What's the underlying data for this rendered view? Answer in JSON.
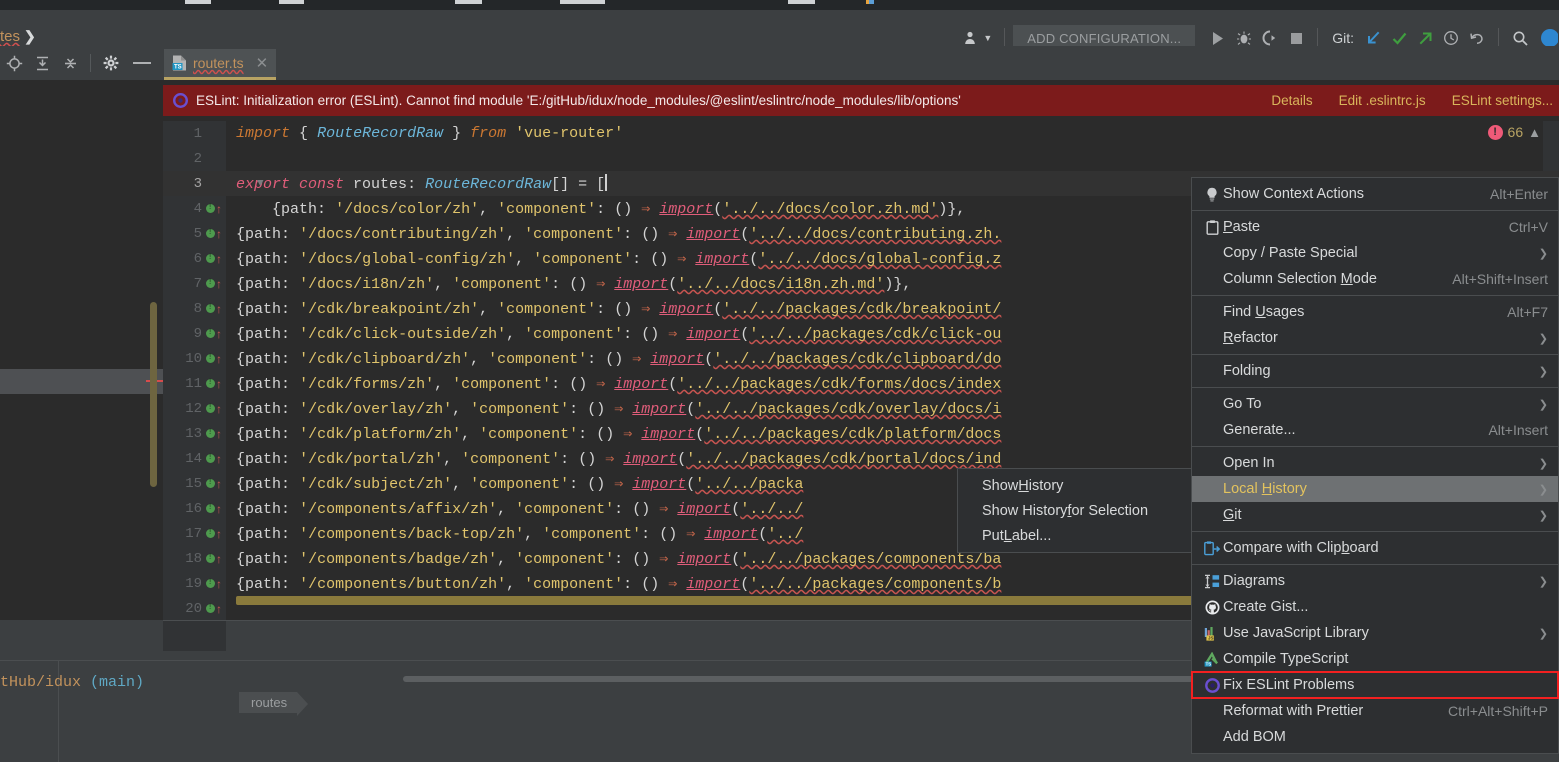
{
  "window": {
    "breadcrumb_tail": "tes",
    "branch_status": "tHub/idux (main)"
  },
  "navbar": {
    "user_icon": "user-dropdown-icon",
    "add_configuration": "ADD CONFIGURATION...",
    "run_icon": "run-icon",
    "debug_icon": "debug-icon",
    "coverage_icon": "run-with-coverage-icon",
    "stop_icon": "stop-icon",
    "git_label": "Git:",
    "update_project_icon": "update-project-icon",
    "commit_icon": "commit-checkmark-icon",
    "push_icon": "push-arrow-icon",
    "history_icon": "history-clock-icon",
    "rollback_icon": "rollback-undo-icon",
    "search_icon": "search-icon",
    "help_icon": "help-icon"
  },
  "toolstrip": {
    "locate_icon": "locate-target-icon",
    "expand_all_icon": "expand-all-icon",
    "collapse_all_icon": "collapse-all-icon",
    "settings_icon": "gear-icon",
    "hide_icon": "minimize-icon"
  },
  "tab": {
    "filetype_icon": "typescript-file-icon",
    "filename": "router.ts",
    "close_icon": "close-icon"
  },
  "error_banner": {
    "status_icon": "eslint-error-icon",
    "message": "ESLint: Initialization error (ESLint). Cannot find module 'E:/gitHub/idux/node_modules/@eslint/eslintrc/node_modules/lib/options'",
    "actions": [
      "Details",
      "Edit .eslintrc.js",
      "ESLint settings..."
    ],
    "banner_color": "#7c1b1b",
    "action_color": "#d9b55b"
  },
  "inspector": {
    "error_badge": "!",
    "error_count": "66",
    "chevron_icon": "chevron-up-icon"
  },
  "editor": {
    "breadcrumb_chip": "routes",
    "lines": [
      {
        "no": "1",
        "marks": false,
        "html": "<span class=\"kw\">import</span> <span class=\"pln\">{</span> <span class=\"typ\">RouteRecordRaw</span> <span class=\"pln\">}</span> <span class=\"kw\">from</span> <span class=\"str\">'vue-router'</span>"
      },
      {
        "no": "2",
        "marks": false,
        "html": ""
      },
      {
        "no": "3",
        "marks": false,
        "html": "<span class=\"pink\">export const</span> <span class=\"pln\">routes</span><span class=\"pnc\">:</span> <span class=\"typ\">RouteRecordRaw</span><span class=\"pnc\">[] = [</span><span class=\"caret\"></span>"
      },
      {
        "no": "4",
        "marks": true,
        "html": "&nbsp;&nbsp;&nbsp;&nbsp;<span class=\"pln\">{</span><span class=\"pln\">path</span><span class=\"pnc\">:</span> <span class=\"str\">'/docs/color/zh'</span><span class=\"pnc\">,</span> <span class=\"str\">'component'</span><span class=\"pnc\">:</span> <span class=\"pnc\">()</span> <span class=\"arrowfat\">&rArr;</span> <span class=\"imp\">import</span><span class=\"pnc\">(</span><span class=\"str squiggle\">'../../docs/color.zh.md'</span><span class=\"pnc\">)},</span>"
      },
      {
        "no": "5",
        "marks": true,
        "html": "<span class=\"pln\">{</span><span class=\"pln\">path</span><span class=\"pnc\">:</span> <span class=\"str\">'/docs/contributing/zh'</span><span class=\"pnc\">,</span> <span class=\"str\">'component'</span><span class=\"pnc\">:</span> <span class=\"pnc\">()</span> <span class=\"arrowfat\">&rArr;</span> <span class=\"imp\">import</span><span class=\"pnc\">(</span><span class=\"str squiggle\">'../../docs/contributing.zh.</span>"
      },
      {
        "no": "6",
        "marks": true,
        "html": "<span class=\"pln\">{</span><span class=\"pln\">path</span><span class=\"pnc\">:</span> <span class=\"str\">'/docs/global-config/zh'</span><span class=\"pnc\">,</span> <span class=\"str\">'component'</span><span class=\"pnc\">:</span> <span class=\"pnc\">()</span> <span class=\"arrowfat\">&rArr;</span> <span class=\"imp\">import</span><span class=\"pnc\">(</span><span class=\"str squiggle\">'../../docs/global-config.z</span>"
      },
      {
        "no": "7",
        "marks": true,
        "html": "<span class=\"pln\">{</span><span class=\"pln\">path</span><span class=\"pnc\">:</span> <span class=\"str\">'/docs/i18n/zh'</span><span class=\"pnc\">,</span> <span class=\"str\">'component'</span><span class=\"pnc\">:</span> <span class=\"pnc\">()</span> <span class=\"arrowfat\">&rArr;</span> <span class=\"imp\">import</span><span class=\"pnc\">(</span><span class=\"str squiggle\">'../../docs/i18n.zh.md'</span><span class=\"pnc\">)},</span>"
      },
      {
        "no": "8",
        "marks": true,
        "html": "<span class=\"pln\">{</span><span class=\"pln\">path</span><span class=\"pnc\">:</span> <span class=\"str\">'/cdk/breakpoint/zh'</span><span class=\"pnc\">,</span> <span class=\"str\">'component'</span><span class=\"pnc\">:</span> <span class=\"pnc\">()</span> <span class=\"arrowfat\">&rArr;</span> <span class=\"imp\">import</span><span class=\"pnc\">(</span><span class=\"str squiggle\">'../../packages/cdk/breakpoint/</span>"
      },
      {
        "no": "9",
        "marks": true,
        "html": "<span class=\"pln\">{</span><span class=\"pln\">path</span><span class=\"pnc\">:</span> <span class=\"str\">'/cdk/click-outside/zh'</span><span class=\"pnc\">,</span> <span class=\"str\">'component'</span><span class=\"pnc\">:</span> <span class=\"pnc\">()</span> <span class=\"arrowfat\">&rArr;</span> <span class=\"imp\">import</span><span class=\"pnc\">(</span><span class=\"str squiggle\">'../../packages/cdk/click-ou</span>"
      },
      {
        "no": "10",
        "marks": true,
        "html": "<span class=\"pln\">{</span><span class=\"pln\">path</span><span class=\"pnc\">:</span> <span class=\"str\">'/cdk/clipboard/zh'</span><span class=\"pnc\">,</span> <span class=\"str\">'component'</span><span class=\"pnc\">:</span> <span class=\"pnc\">()</span> <span class=\"arrowfat\">&rArr;</span> <span class=\"imp\">import</span><span class=\"pnc\">(</span><span class=\"str squiggle\">'../../packages/cdk/clipboard/do</span>"
      },
      {
        "no": "11",
        "marks": true,
        "html": "<span class=\"pln\">{</span><span class=\"pln\">path</span><span class=\"pnc\">:</span> <span class=\"str\">'/cdk/forms/zh'</span><span class=\"pnc\">,</span> <span class=\"str\">'component'</span><span class=\"pnc\">:</span> <span class=\"pnc\">()</span> <span class=\"arrowfat\">&rArr;</span> <span class=\"imp\">import</span><span class=\"pnc\">(</span><span class=\"str squiggle\">'../../packages/cdk/forms/docs/index</span>"
      },
      {
        "no": "12",
        "marks": true,
        "html": "<span class=\"pln\">{</span><span class=\"pln\">path</span><span class=\"pnc\">:</span> <span class=\"str\">'/cdk/overlay/zh'</span><span class=\"pnc\">,</span> <span class=\"str\">'component'</span><span class=\"pnc\">:</span> <span class=\"pnc\">()</span> <span class=\"arrowfat\">&rArr;</span> <span class=\"imp\">import</span><span class=\"pnc\">(</span><span class=\"str squiggle\">'../../packages/cdk/overlay/docs/i</span>"
      },
      {
        "no": "13",
        "marks": true,
        "html": "<span class=\"pln\">{</span><span class=\"pln\">path</span><span class=\"pnc\">:</span> <span class=\"str\">'/cdk/platform/zh'</span><span class=\"pnc\">,</span> <span class=\"str\">'component'</span><span class=\"pnc\">:</span> <span class=\"pnc\">()</span> <span class=\"arrowfat\">&rArr;</span> <span class=\"imp\">import</span><span class=\"pnc\">(</span><span class=\"str squiggle\">'../../packages/cdk/platform/docs</span>"
      },
      {
        "no": "14",
        "marks": true,
        "html": "<span class=\"pln\">{</span><span class=\"pln\">path</span><span class=\"pnc\">:</span> <span class=\"str\">'/cdk/portal/zh'</span><span class=\"pnc\">,</span> <span class=\"str\">'component'</span><span class=\"pnc\">:</span> <span class=\"pnc\">()</span> <span class=\"arrowfat\">&rArr;</span> <span class=\"imp\">import</span><span class=\"pnc\">(</span><span class=\"str squiggle\">'../../packages/cdk/portal/docs/ind</span>"
      },
      {
        "no": "15",
        "marks": true,
        "html": "<span class=\"pln\">{</span><span class=\"pln\">path</span><span class=\"pnc\">:</span> <span class=\"str\">'/cdk/subject/zh'</span><span class=\"pnc\">,</span> <span class=\"str\">'component'</span><span class=\"pnc\">:</span> <span class=\"pnc\">()</span> <span class=\"arrowfat\">&rArr;</span> <span class=\"imp\">import</span><span class=\"pnc\">(</span><span class=\"str squiggle\">'../../packa</span>"
      },
      {
        "no": "16",
        "marks": true,
        "html": "<span class=\"pln\">{</span><span class=\"pln\">path</span><span class=\"pnc\">:</span> <span class=\"str\">'/components/affix/zh'</span><span class=\"pnc\">,</span> <span class=\"str\">'component'</span><span class=\"pnc\">:</span> <span class=\"pnc\">()</span> <span class=\"arrowfat\">&rArr;</span> <span class=\"imp\">import</span><span class=\"pnc\">(</span><span class=\"str squiggle\">'../../</span>"
      },
      {
        "no": "17",
        "marks": true,
        "html": "<span class=\"pln\">{</span><span class=\"pln\">path</span><span class=\"pnc\">:</span> <span class=\"str\">'/components/back-top/zh'</span><span class=\"pnc\">,</span> <span class=\"str\">'component'</span><span class=\"pnc\">:</span> <span class=\"pnc\">()</span> <span class=\"arrowfat\">&rArr;</span> <span class=\"imp\">import</span><span class=\"pnc\">(</span><span class=\"str squiggle\">'../</span>"
      },
      {
        "no": "18",
        "marks": true,
        "html": "<span class=\"pln\">{</span><span class=\"pln\">path</span><span class=\"pnc\">:</span> <span class=\"str\">'/components/badge/zh'</span><span class=\"pnc\">,</span> <span class=\"str\">'component'</span><span class=\"pnc\">:</span> <span class=\"pnc\">()</span> <span class=\"arrowfat\">&rArr;</span> <span class=\"imp\">import</span><span class=\"pnc\">(</span><span class=\"str squiggle\">'../../packages/components/ba</span>"
      },
      {
        "no": "19",
        "marks": true,
        "html": "<span class=\"pln\">{</span><span class=\"pln\">path</span><span class=\"pnc\">:</span> <span class=\"str\">'/components/button/zh'</span><span class=\"pnc\">,</span> <span class=\"str\">'component'</span><span class=\"pnc\">:</span> <span class=\"pnc\">()</span> <span class=\"arrowfat\">&rArr;</span> <span class=\"imp\">import</span><span class=\"pnc\">(</span><span class=\"str squiggle\">'../../packages/components/b</span>"
      },
      {
        "no": "20",
        "marks": true,
        "html": ""
      }
    ]
  },
  "local_history_submenu": {
    "items": [
      {
        "label_pre": "Show ",
        "label_u": "H",
        "label_post": "istory"
      },
      {
        "label_pre": "Show History ",
        "label_u": "f",
        "label_post": "or Selection"
      },
      {
        "label_pre": "Put ",
        "label_u": "L",
        "label_post": "abel..."
      }
    ]
  },
  "context_menu": {
    "items": [
      {
        "icon": "lightbulb-icon",
        "label": "Show Context Actions",
        "shortcut": "Alt+Enter",
        "selected": false,
        "highlighted": false,
        "separator_after": true,
        "submenu": false
      },
      {
        "icon": "clipboard-paste-icon",
        "label": "Paste",
        "shortcut": "Ctrl+V",
        "selected": false,
        "highlighted": false,
        "separator_after": false,
        "submenu": false
      },
      {
        "icon": "",
        "label": "Copy / Paste Special",
        "shortcut": "",
        "selected": false,
        "highlighted": false,
        "separator_after": false,
        "submenu": true
      },
      {
        "icon": "",
        "label": "Column Selection Mode",
        "shortcut": "Alt+Shift+Insert",
        "selected": false,
        "highlighted": false,
        "separator_after": true,
        "submenu": false
      },
      {
        "icon": "",
        "label": "Find Usages",
        "shortcut": "Alt+F7",
        "selected": false,
        "highlighted": false,
        "separator_after": false,
        "submenu": false
      },
      {
        "icon": "",
        "label": "Refactor",
        "shortcut": "",
        "selected": false,
        "highlighted": false,
        "separator_after": true,
        "submenu": true
      },
      {
        "icon": "",
        "label": "Folding",
        "shortcut": "",
        "selected": false,
        "highlighted": false,
        "separator_after": true,
        "submenu": true
      },
      {
        "icon": "",
        "label": "Go To",
        "shortcut": "",
        "selected": false,
        "highlighted": false,
        "separator_after": false,
        "submenu": true
      },
      {
        "icon": "",
        "label": "Generate...",
        "shortcut": "Alt+Insert",
        "selected": false,
        "highlighted": false,
        "separator_after": true,
        "submenu": false
      },
      {
        "icon": "",
        "label": "Open In",
        "shortcut": "",
        "selected": false,
        "highlighted": false,
        "separator_after": false,
        "submenu": true
      },
      {
        "icon": "",
        "label": "Local History",
        "shortcut": "",
        "selected": true,
        "highlighted": false,
        "separator_after": false,
        "submenu": true
      },
      {
        "icon": "",
        "label": "Git",
        "shortcut": "",
        "selected": false,
        "highlighted": false,
        "separator_after": true,
        "submenu": true
      },
      {
        "icon": "compare-clipboard-icon",
        "label": "Compare with Clipboard",
        "shortcut": "",
        "selected": false,
        "highlighted": false,
        "separator_after": true,
        "submenu": false
      },
      {
        "icon": "diagrams-icon",
        "label": "Diagrams",
        "shortcut": "",
        "selected": false,
        "highlighted": false,
        "separator_after": false,
        "submenu": true
      },
      {
        "icon": "github-icon",
        "label": "Create Gist...",
        "shortcut": "",
        "selected": false,
        "highlighted": false,
        "separator_after": false,
        "submenu": false
      },
      {
        "icon": "js-library-icon",
        "label": "Use JavaScript Library",
        "shortcut": "",
        "selected": false,
        "highlighted": false,
        "separator_after": false,
        "submenu": true
      },
      {
        "icon": "typescript-icon",
        "label": "Compile TypeScript",
        "shortcut": "",
        "selected": false,
        "highlighted": false,
        "separator_after": false,
        "submenu": false
      },
      {
        "icon": "eslint-icon",
        "label": "Fix ESLint Problems",
        "shortcut": "",
        "selected": false,
        "highlighted": true,
        "separator_after": false,
        "submenu": false
      },
      {
        "icon": "",
        "label": "Reformat with Prettier",
        "shortcut": "Ctrl+Alt+Shift+P",
        "selected": false,
        "highlighted": false,
        "separator_after": false,
        "submenu": false
      },
      {
        "icon": "",
        "label": "Add BOM",
        "shortcut": "",
        "selected": false,
        "highlighted": false,
        "separator_after": false,
        "submenu": false
      }
    ],
    "highlight_color": "#f32020",
    "selected_color": "#6e7173"
  }
}
